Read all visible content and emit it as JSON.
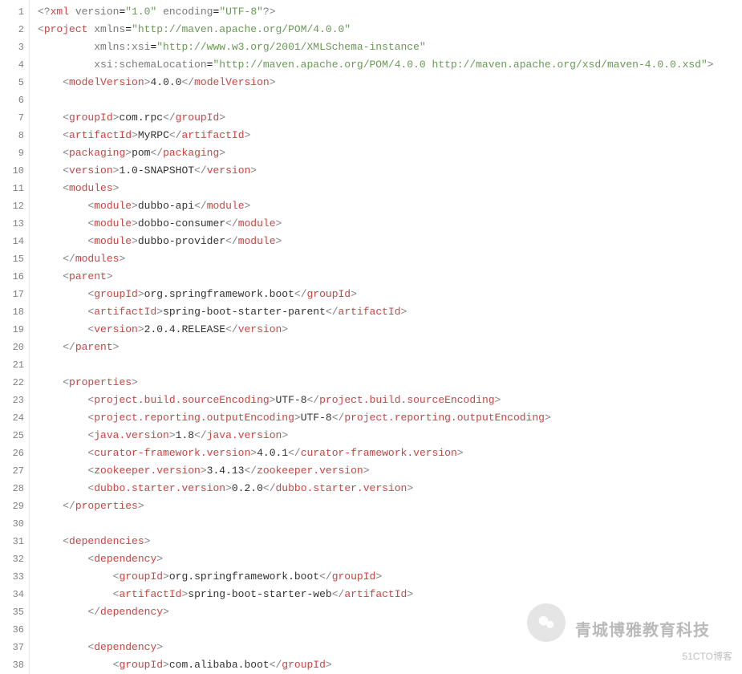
{
  "line_count": 38,
  "watermark": {
    "main": "青城博雅教育科技",
    "sub": "51CTO博客"
  },
  "xml": {
    "declaration": {
      "version": "1.0",
      "encoding": "UTF-8"
    },
    "project": {
      "xmlns": "http://maven.apache.org/POM/4.0.0",
      "xmlns_xsi": "http://www.w3.org/2001/XMLSchema-instance",
      "xsi_schemaLocation": "http://maven.apache.org/POM/4.0.0 http://maven.apache.org/xsd/maven-4.0.0.xsd",
      "modelVersion": "4.0.0",
      "groupId": "com.rpc",
      "artifactId": "MyRPC",
      "packaging": "pom",
      "version": "1.0-SNAPSHOT",
      "modules": [
        "dubbo-api",
        "dobbo-consumer",
        "dubbo-provider"
      ],
      "parent": {
        "groupId": "org.springframework.boot",
        "artifactId": "spring-boot-starter-parent",
        "version": "2.0.4.RELEASE"
      },
      "properties": {
        "project.build.sourceEncoding": "UTF-8",
        "project.reporting.outputEncoding": "UTF-8",
        "java.version": "1.8",
        "curator-framework.version": "4.0.1",
        "zookeeper.version": "3.4.13",
        "dubbo.starter.version": "0.2.0"
      },
      "dependencies": [
        {
          "groupId": "org.springframework.boot",
          "artifactId": "spring-boot-starter-web"
        },
        {
          "groupId": "com.alibaba.boot"
        }
      ]
    }
  }
}
